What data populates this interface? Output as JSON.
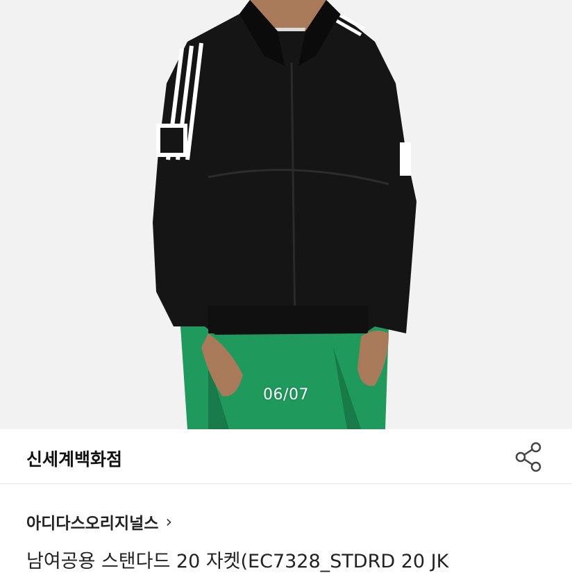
{
  "product_image": {
    "counter": "06/07",
    "alt_icon": "jacket-photo"
  },
  "store": {
    "name": "신세계백화점",
    "share_icon": "share-icon"
  },
  "brand": {
    "name": "아디다스오리지널스",
    "chevron": "›"
  },
  "product": {
    "title": "남여공용 스탠다드 20 자켓(EC7328_STDRD 20 JK"
  },
  "colors": {
    "jacket": "#111111",
    "pants": "#1f9a5c",
    "stripe": "#ffffff",
    "background": "#f1f1f1"
  }
}
